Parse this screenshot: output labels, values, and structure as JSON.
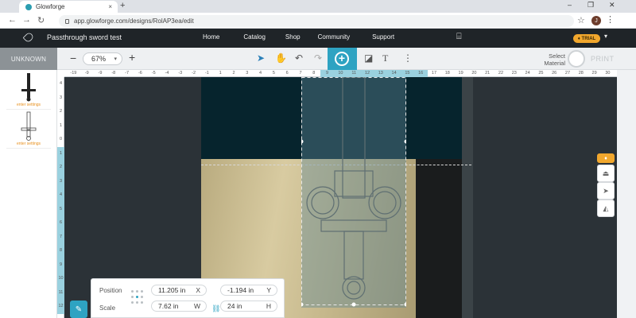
{
  "browser": {
    "tab_title": "Glowforge",
    "tab_close": "×",
    "new_tab": "+",
    "url": "app.glowforge.com/designs/RolAP3ea/edit",
    "avatar_initial": "J",
    "window_controls": [
      "–",
      "❐",
      "✕"
    ]
  },
  "app": {
    "document_title": "Passthrough sword test",
    "nav": [
      "Home",
      "Catalog",
      "Shop",
      "Community",
      "Support"
    ],
    "trial_badge": "TRIAL"
  },
  "toolbar": {
    "material_status": "UNKNOWN",
    "zoom_minus": "−",
    "zoom_value": "67%",
    "zoom_plus": "+",
    "select_material": "Select Material",
    "print_label": "PRINT"
  },
  "thumbnails": [
    {
      "caption": "enter settings"
    },
    {
      "caption": "enter settings"
    }
  ],
  "ruler": {
    "top": [
      "-19",
      "-9",
      "-9",
      "-8",
      "-7",
      "-6",
      "-5",
      "-4",
      "-3",
      "-2",
      "-1",
      "1",
      "2",
      "3",
      "4",
      "5",
      "6",
      "7",
      "8",
      "9",
      "10",
      "11",
      "12",
      "13",
      "14",
      "15",
      "16",
      "17",
      "18",
      "19",
      "20",
      "21",
      "22",
      "23",
      "24",
      "25",
      "26",
      "27",
      "28",
      "29",
      "30"
    ],
    "left": [
      "4",
      "3",
      "2",
      "1",
      "0",
      "1",
      "2",
      "3",
      "4",
      "5",
      "6",
      "7",
      "8",
      "9",
      "10",
      "11",
      "12"
    ]
  },
  "properties": {
    "position_label": "Position",
    "scale_label": "Scale",
    "x_value": "11.205 in",
    "x_axis": "X",
    "y_value": "-1.194 in",
    "y_axis": "Y",
    "w_value": "7.62 in",
    "w_axis": "W",
    "h_value": "24 in",
    "h_axis": "H"
  },
  "colors": {
    "accent": "#2ea3c2",
    "trial": "#f1a72d",
    "nav_bg": "#1f2428",
    "thumb_caption": "#e8901d"
  },
  "icons": [
    "glowforge-logo-icon",
    "lock-icon",
    "star-icon",
    "gift-icon",
    "pointer-icon",
    "pan-hand-icon",
    "undo-icon",
    "redo-icon",
    "add-circle-icon",
    "shapes-icon",
    "text-icon",
    "more-icon",
    "link-icon",
    "pin-icon"
  ]
}
